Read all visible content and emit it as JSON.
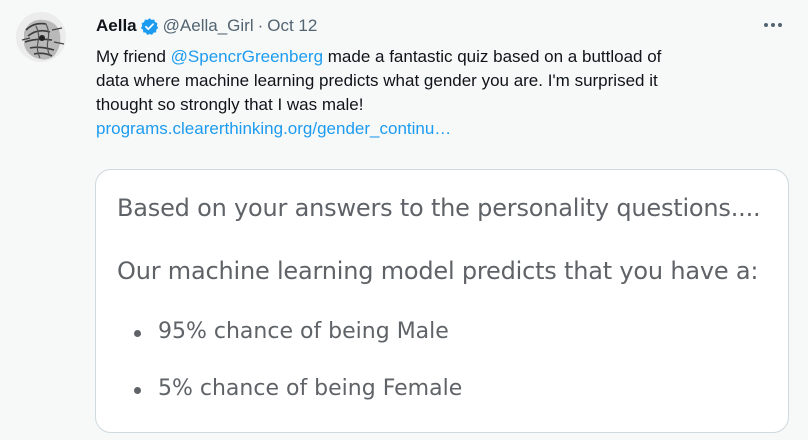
{
  "tweet": {
    "author_name": "Aella",
    "handle": "@Aella_Girl",
    "separator": "·",
    "date": "Oct 12",
    "text_line1_pre": "My friend ",
    "mention": "@SpencrGreenberg",
    "text_line1_post": " made a fantastic quiz based on a buttload of",
    "text_line2": "data where machine learning predicts what gender you are. I'm surprised it",
    "text_line3": "thought so strongly that I was male!",
    "link": "programs.clearerthinking.org/gender_continu…"
  },
  "card": {
    "line1": "Based on your answers to the personality questions....",
    "line2": "Our machine learning model predicts that you have a:",
    "items": [
      "95% chance of being Male",
      "5% chance of being Female"
    ]
  },
  "colors": {
    "accent": "#1d9bf0",
    "muted": "#536471",
    "background": "#f7f9f9"
  },
  "icons": {
    "verified": "verified-badge-icon",
    "more": "more-options-icon"
  }
}
